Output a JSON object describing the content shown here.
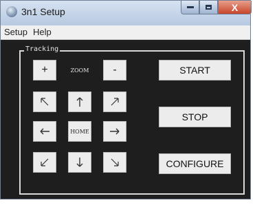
{
  "window": {
    "title": "3n1 Setup"
  },
  "menu": {
    "setup": "Setup",
    "help": "Help"
  },
  "tracking": {
    "label": "Tracking",
    "zoom_in": "+",
    "zoom_label": "ZOOM",
    "zoom_out": "-",
    "home": "HOME"
  },
  "actions": {
    "start": "START",
    "stop": "STOP",
    "configure": "CONFIGURE"
  },
  "window_controls": {
    "close": "X"
  }
}
